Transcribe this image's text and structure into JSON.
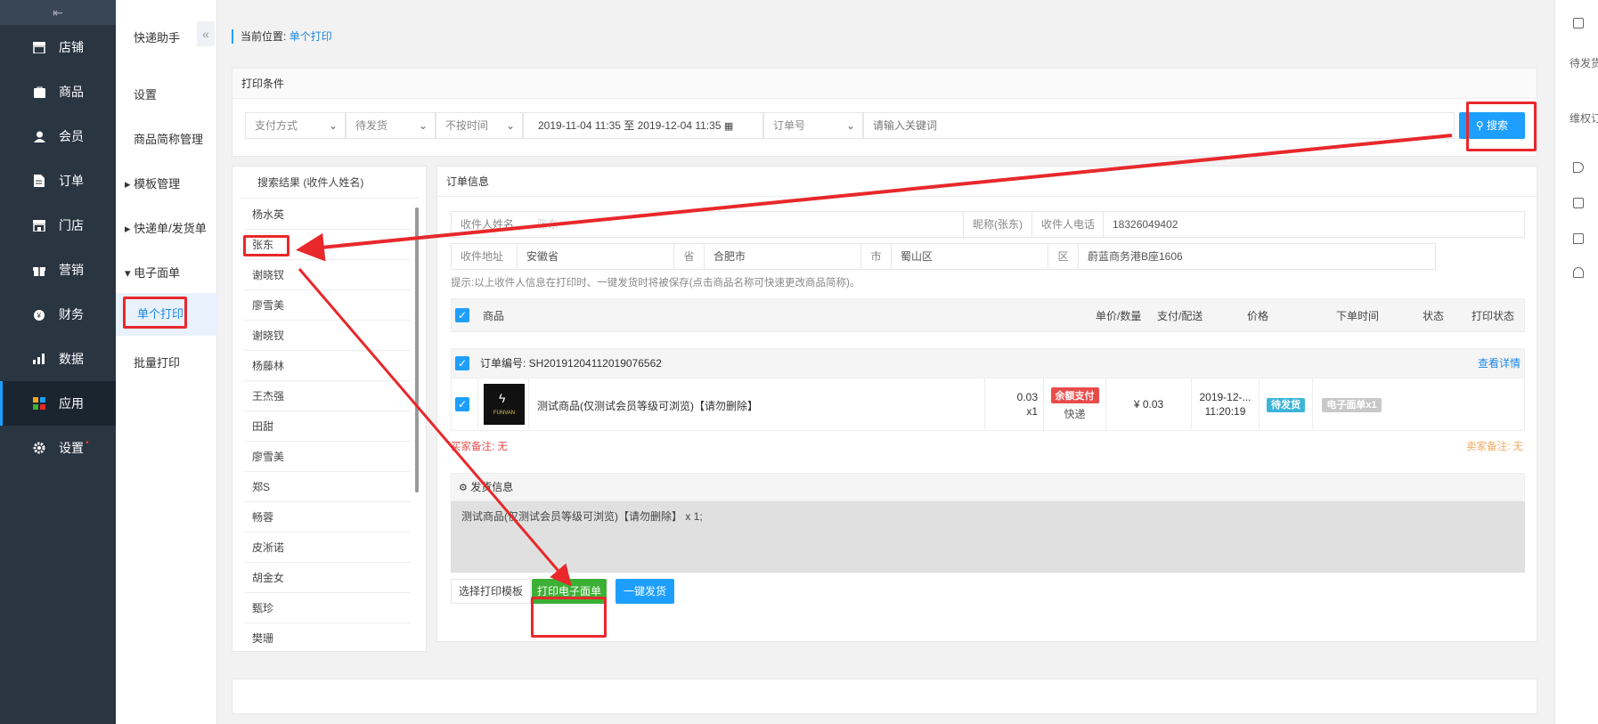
{
  "nav": {
    "items": [
      {
        "label": "店铺",
        "icon": "store-icon"
      },
      {
        "label": "商品",
        "icon": "bag-icon"
      },
      {
        "label": "会员",
        "icon": "user-icon"
      },
      {
        "label": "订单",
        "icon": "document-icon"
      },
      {
        "label": "门店",
        "icon": "shop-icon"
      },
      {
        "label": "营销",
        "icon": "gift-icon"
      },
      {
        "label": "财务",
        "icon": "money-icon"
      },
      {
        "label": "数据",
        "icon": "bar-chart-icon"
      },
      {
        "label": "应用",
        "icon": "apps-icon"
      },
      {
        "label": "设置",
        "icon": "gear-icon"
      }
    ],
    "settings_dot": "•"
  },
  "subnav": {
    "title": "快递助手",
    "items": [
      "设置",
      "商品简称管理",
      "模板管理",
      "快递单/发货单",
      "电子面单",
      "单个打印",
      "批量打印"
    ]
  },
  "breadcrumb": {
    "prefix": "当前位置:",
    "current": "单个打印"
  },
  "print_conditions": {
    "title": "打印条件",
    "payment": "支付方式",
    "status": "待发货",
    "time": "不按时间",
    "date_range": "2019-11-04 11:35 至 2019-12-04 11:35",
    "order_field": "订单号",
    "keyword_placeholder": "请输入关键词",
    "search_label": "搜索"
  },
  "results": {
    "title": "搜索结果 (收件人姓名)",
    "names": [
      "杨水英",
      "张东",
      "谢晓钗",
      "廖雪美",
      "谢晓钗",
      "杨藤林",
      "王杰强",
      "田甜",
      "廖雪美",
      "郑S",
      "畅蓉",
      "皮淅诺",
      "胡金女",
      "甄珍",
      "樊珊"
    ]
  },
  "order": {
    "title": "订单信息",
    "name_label": "收件人姓名",
    "name_value": "张东",
    "nickname": "昵称(张东)",
    "phone_label": "收件人电话",
    "phone": "18326049402",
    "address_label": "收件地址",
    "province": "安徽省",
    "province_unit": "省",
    "city": "合肥市",
    "city_unit": "市",
    "district": "蜀山区",
    "district_unit": "区",
    "detail": "蔚蓝商务港B座1606",
    "hint": "提示:以上收件人信息在打印时、一键发货时将被保存(点击商品名称可快速更改商品简称)。",
    "headers": [
      "商品",
      "单价/数量",
      "支付/配送",
      "价格",
      "下单时间",
      "状态",
      "打印状态"
    ],
    "order_no": "订单编号: SH20191204112019076562",
    "view_detail": "查看详情",
    "product_thumb": "FUNVAN",
    "product_name": "测试商品(仅测试会员等级可浏览)【请勿删除】",
    "unit_price": "0.03",
    "quantity": "x1",
    "pay_tag": "余额支付",
    "delivery": "快递",
    "price": "¥ 0.03",
    "order_date": "2019-12-...",
    "order_time": "11:20:19",
    "status_tag": "待发货",
    "print_tag": "电子面单x1",
    "buyer_note": "买家备注: 无",
    "seller_note": "卖家备注: 无",
    "ship_title": "发货信息",
    "ship_content": "测试商品(仅测试会员等级可浏览)【请勿删除】 x 1;",
    "select_template": "选择打印模板",
    "print_button": "打印电子面单",
    "ship_button": "一键发货"
  },
  "rightbar": {
    "items": [
      "待发货",
      "维权订"
    ]
  },
  "colors": {
    "accent": "#1e9fff",
    "annotation": "#e8282b",
    "green": "#3cb035",
    "nav_bg": "#2a3542"
  }
}
